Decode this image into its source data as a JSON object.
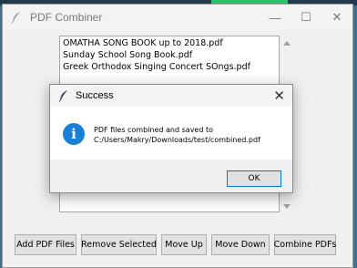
{
  "window": {
    "title": "PDF Combiner",
    "controls": {
      "minimize": "—",
      "maximize": "☐",
      "close": "✕"
    }
  },
  "listbox": {
    "items": [
      "OMATHA SONG BOOK up to 2018.pdf",
      "Sunday School Song Book.pdf",
      "Greek Orthodox Singing Concert SOngs.pdf"
    ]
  },
  "buttons": {
    "add": "Add PDF Files",
    "remove": "Remove Selected",
    "move_up": "Move Up",
    "move_down": "Move Down",
    "combine": "Combine PDFs"
  },
  "dialog": {
    "title": "Success",
    "close": "✕",
    "message_line1": "PDF files combined and saved to",
    "message_line2": "C:/Users/Makry/Downloads/test/combined.pdf",
    "icon_glyph": "i",
    "ok": "OK"
  },
  "icons": {
    "app": "feather-icon",
    "info": "info-icon"
  },
  "colors": {
    "info_blue": "#1a7fd6",
    "focus_border": "#0078d7"
  }
}
